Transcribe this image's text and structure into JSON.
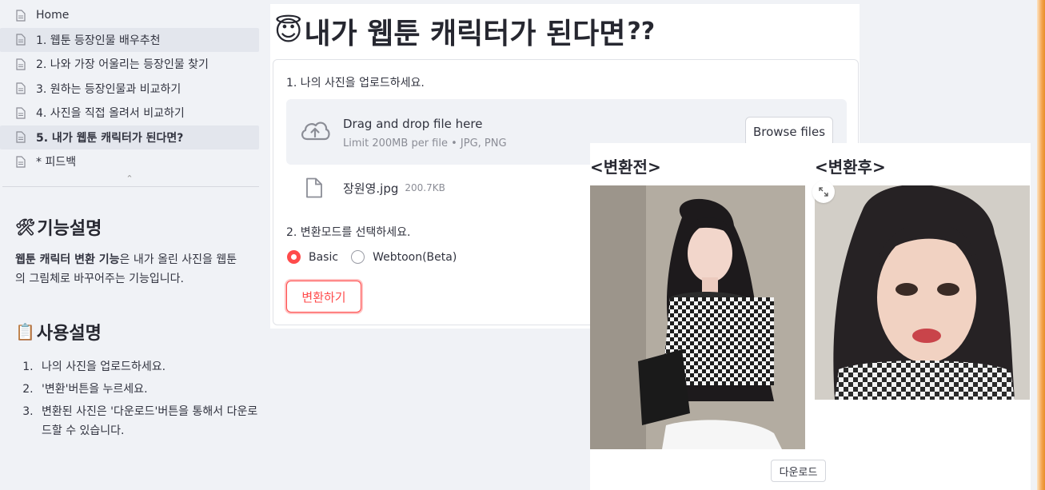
{
  "sidebar": {
    "nav": [
      {
        "label": "Home"
      },
      {
        "label": "1. 웹툰 등장인물 배우추천"
      },
      {
        "label": "2. 나와 가장 어울리는 등장인물 찾기"
      },
      {
        "label": "3. 원하는 등장인물과 비교하기"
      },
      {
        "label": "4. 사진을 직접 올려서 비교하기"
      },
      {
        "label": "5. 내가 웹툰 캐릭터가 된다면?"
      },
      {
        "label": "* 피드백"
      }
    ],
    "collapse_glyph": "⌃",
    "feature": {
      "emoji": "🛠",
      "heading": "기능설명",
      "bold": "웹툰 캐릭터 변환 기능",
      "text": "은 내가 올린 사진을 웹툰의 그림체로 바꾸어주는 기능입니다."
    },
    "usage": {
      "emoji": "📋",
      "heading": "사용설명",
      "steps": [
        "나의 사진을 업로드하세요.",
        "'변환'버튼을 누르세요.",
        "변환된 사진은 '다운로드'버튼을 통해서 다운로드할 수 있습니다."
      ]
    }
  },
  "main": {
    "title_emoji": "😇",
    "title": "내가 웹툰 캐릭터가 된다면",
    "title_suffix": "??",
    "upload_label": "1. 나의 사진을 업로드하세요.",
    "dropzone": {
      "primary": "Drag and drop file here",
      "secondary": "Limit 200MB per file • JPG, PNG",
      "browse": "Browse files"
    },
    "file": {
      "name": "장원영.jpg",
      "size": "200.7KB"
    },
    "mode_label": "2. 변환모드를 선택하세요.",
    "modes": [
      {
        "label": "Basic",
        "selected": true
      },
      {
        "label": "Webtoon(Beta)",
        "selected": false
      }
    ],
    "convert_button": "변환하기"
  },
  "result": {
    "before_label": "<변환전>",
    "after_label": "<변환후>",
    "download_button": "다운로드"
  },
  "colors": {
    "accent": "#ff4b4b",
    "sidebar_bg": "#f0f2f6",
    "text": "#31333f"
  }
}
